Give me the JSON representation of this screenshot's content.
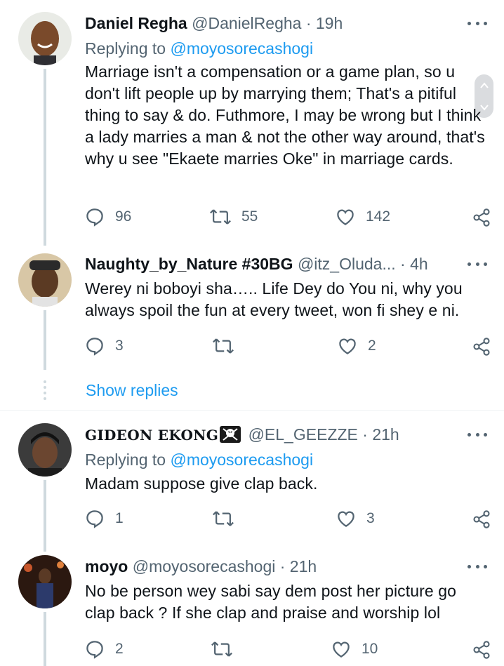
{
  "tweets": [
    {
      "name": "Daniel Regha",
      "handle": "@DanielRegha",
      "dot": "·",
      "time": "19h",
      "replying_label": "Replying to",
      "replying_handle": "@moyosorecashogi",
      "text": "Marriage isn't a compensation or a game plan, so u don't lift people up by marrying them; That's a pitiful thing to say & do. Futhmore, I may be wrong but I think a lady marries a man & not the other way around, that's why u see \"Ekaete marries Oke\" in marriage cards.",
      "replies": "96",
      "retweets": "55",
      "likes": "142"
    },
    {
      "name": "Naughty_by_Nature #30BG",
      "handle": "@itz_Oluda...",
      "dot": "·",
      "time": "4h",
      "text": "Werey ni boboyi sha….. Life Dey do You ni, why you always spoil the fun at every tweet, won fi shey e ni.",
      "replies": "3",
      "retweets": "",
      "likes": "2"
    },
    {
      "name": "GIDEON EKONG",
      "handle": "@EL_GEEZZE",
      "dot": "·",
      "time": "21h",
      "replying_label": "Replying to",
      "replying_handle": "@moyosorecashogi",
      "text": "Madam suppose give clap back.",
      "replies": "1",
      "retweets": "",
      "likes": "3"
    },
    {
      "name": "moyo",
      "handle": "@moyosorecashogi",
      "dot": "·",
      "time": "21h",
      "text": "No be person wey sabi say dem post her picture go clap back ? If she clap and praise and worship lol",
      "replies": "2",
      "retweets": "",
      "likes": "10"
    }
  ],
  "show_replies": "Show replies",
  "colors": {
    "accent": "#1d9bf0",
    "muted": "#536471",
    "line": "#cfd9de"
  },
  "icons": [
    "reply-icon",
    "retweet-icon",
    "like-icon",
    "share-icon",
    "more-icon",
    "skull-crossbones-icon"
  ]
}
